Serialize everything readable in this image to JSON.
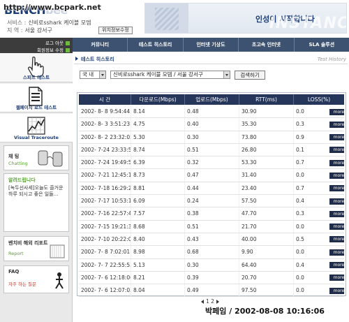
{
  "watermark": "http://www.bcpark.net",
  "header": {
    "logo_main": "BENCH",
    "logo_rest": "bee",
    "service_key": "서비스 :",
    "service_value": "신비로sshark 케이블 모뎀",
    "region_key": "지  역 :",
    "region_value": "서울 강서구",
    "change_button": "위치정보수정",
    "banner_text": "인성이 시작합니다",
    "banner_watermark": "INSTANC"
  },
  "account": {
    "logout": "로그 아웃",
    "edit_info": "회원정보 수정"
  },
  "topnav": [
    "커뮤니티",
    "테스트 히스토리",
    "인터넷 기상도",
    "초고속 인터넷",
    "SLA 솔루션"
  ],
  "sidebar": {
    "items": [
      {
        "label": "스피드 테스트",
        "icon": "hand-cursor-icon"
      },
      {
        "label": "웹페이지 로드 테스트",
        "icon": "document-icon"
      },
      {
        "label": "Visual Traceroute",
        "icon": "graph-icon"
      }
    ],
    "chat": {
      "title": "채 팅",
      "sub": "Chatting"
    },
    "notice": {
      "title": "알려드립니다",
      "body": "[녹두선사세]오늘도 즐거운 하루 되시고 좋은 일들..."
    },
    "report": {
      "title": "벤치비 해외 리포트",
      "sub": "Report"
    },
    "faq": {
      "title": "FAQ",
      "sub": "자주 하는 질문"
    }
  },
  "section": {
    "title": "테스트 히스토리",
    "eng": "Test History"
  },
  "filters": {
    "scope": "국 내",
    "service": "신비로sshark 케이블 모뎀 / 서울 강서구",
    "search_button": "검색하기"
  },
  "table": {
    "headers": [
      "시  간",
      "다운로드(Mbps)",
      "업로드(Mbps)",
      "RTT(ms)",
      "LOSS(%)"
    ],
    "more_label": "more",
    "rows": [
      [
        "2002- 8- 8  9:54:44",
        "8.14",
        "0.48",
        "30.90",
        "0.0"
      ],
      [
        "2002- 8- 3  3:51:23",
        "4.75",
        "0.40",
        "35.30",
        "0.3"
      ],
      [
        "2002- 8- 2 23:32:05",
        "5.30",
        "0.30",
        "73.80",
        "0.9"
      ],
      [
        "2002- 7-24 23:33:59",
        "8.74",
        "0.51",
        "26.80",
        "0.1"
      ],
      [
        "2002- 7-24 19:49:53",
        "6.39",
        "0.32",
        "53.30",
        "0.7"
      ],
      [
        "2002- 7-21 12:45:19",
        "8.73",
        "0.47",
        "31.40",
        "0.0"
      ],
      [
        "2002- 7-18 16:29:24",
        "8.81",
        "0.44",
        "23.40",
        "0.7"
      ],
      [
        "2002- 7-17 10:53:16",
        "6.09",
        "0.24",
        "57.50",
        "0.4"
      ],
      [
        "2002- 7-16 22:57:46",
        "7.57",
        "0.38",
        "47.70",
        "0.3"
      ],
      [
        "2002- 7-15 19:21:36",
        "8.68",
        "0.51",
        "21.70",
        "0.0"
      ],
      [
        "2002- 7-10 20:22:05",
        "8.40",
        "0.43",
        "40.00",
        "0.5"
      ],
      [
        "2002- 7- 8  7:02:01",
        "8.98",
        "0.68",
        "9.90",
        "0.0"
      ],
      [
        "2002- 7- 7 22:55:53",
        "5.13",
        "0.30",
        "64.40",
        "0.4"
      ],
      [
        "2002- 7- 6 12:18:00",
        "8.21",
        "0.39",
        "20.70",
        "0.0"
      ],
      [
        "2002- 7- 6 12:07:03",
        "8.04",
        "0.49",
        "97.50",
        "0.0"
      ]
    ]
  },
  "pager": "1 2",
  "footer_stamp": "박페임 / 2002-08-08 10:16:06"
}
